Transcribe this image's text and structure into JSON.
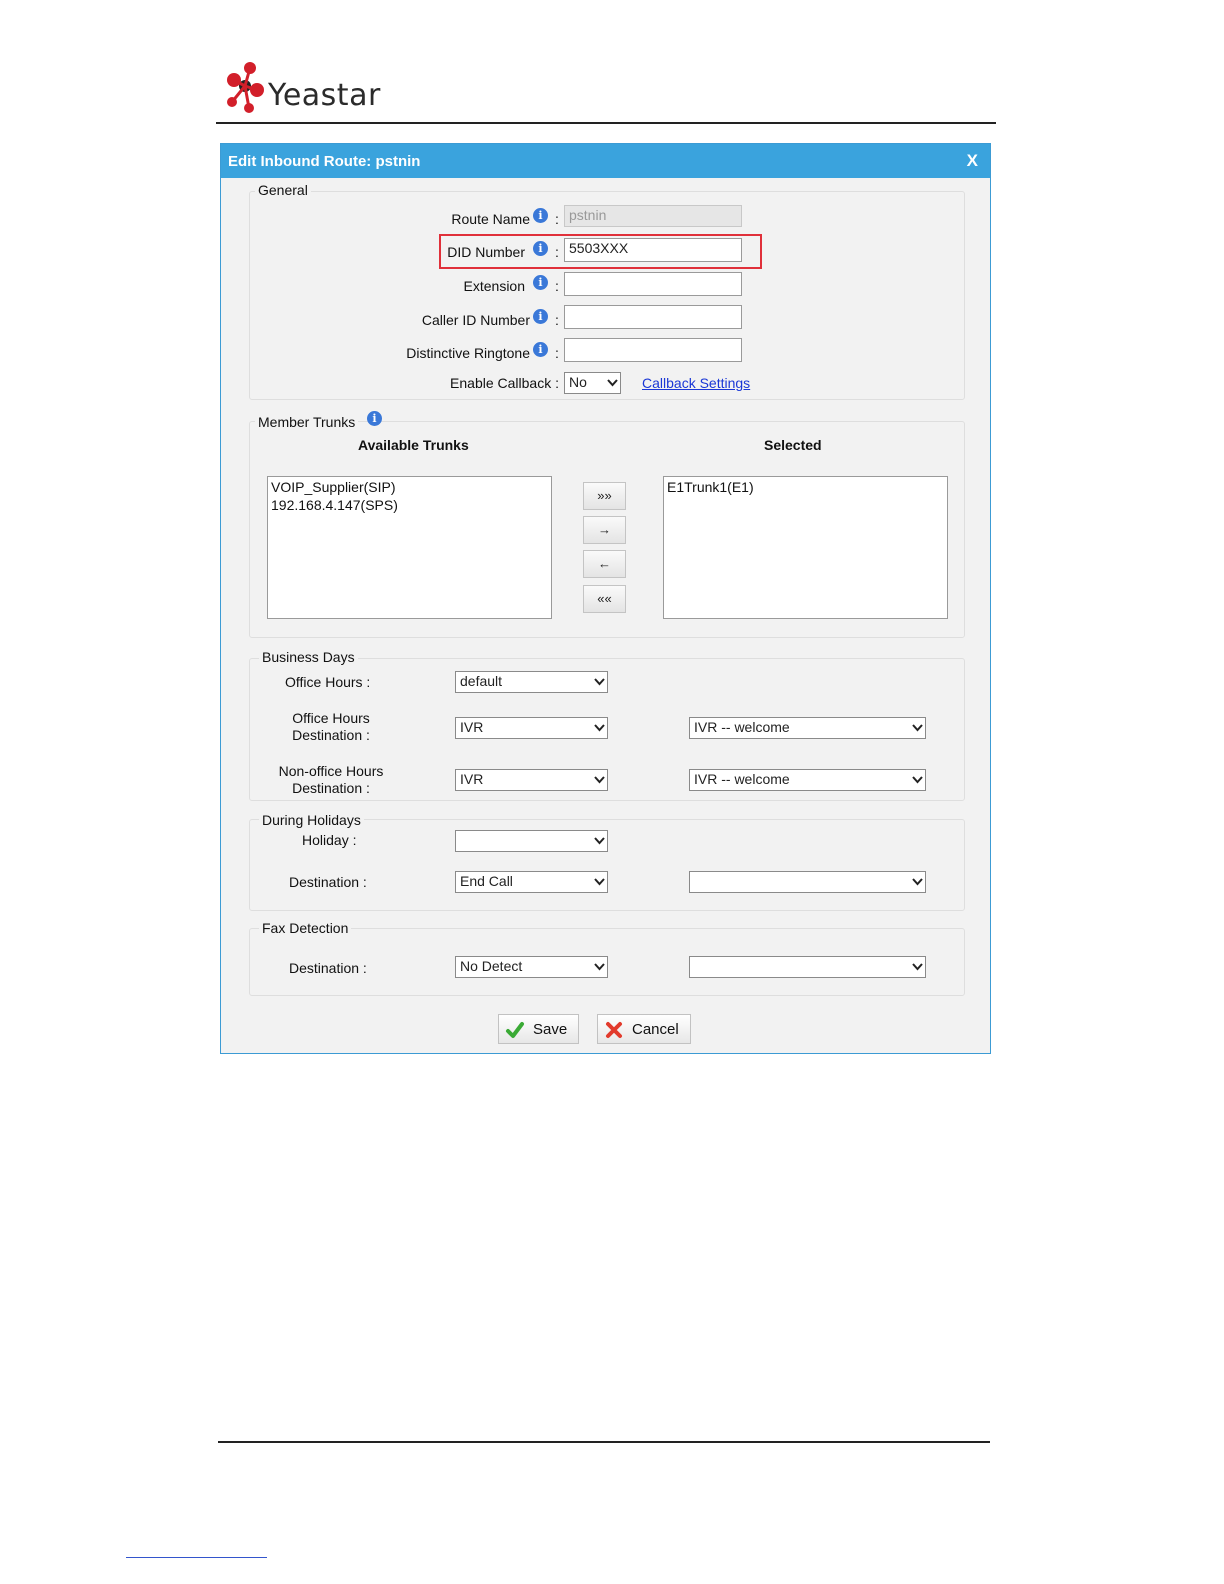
{
  "brand": {
    "logo_text": "Yeastar"
  },
  "dialog": {
    "title": "Edit Inbound Route: pstnin",
    "close_label": "X"
  },
  "general": {
    "legend": "General",
    "route_name": {
      "label": "Route Name",
      "value": "pstnin"
    },
    "did_number": {
      "label": "DID Number",
      "value": "5503XXX"
    },
    "extension": {
      "label": "Extension",
      "value": ""
    },
    "caller_id_number": {
      "label": "Caller ID Number",
      "value": ""
    },
    "distinctive_ringtone": {
      "label": "Distinctive Ringtone",
      "value": ""
    },
    "enable_callback": {
      "label": "Enable Callback :",
      "value": "No",
      "link": "Callback Settings"
    },
    "colon": ":"
  },
  "member_trunks": {
    "legend": "Member Trunks",
    "available_header": "Available Trunks",
    "selected_header": "Selected",
    "available": [
      "VOIP_Supplier(SIP)",
      "192.168.4.147(SPS)"
    ],
    "selected": [
      "E1Trunk1(E1)"
    ],
    "buttons": {
      "add_all": "»»",
      "add": "→",
      "remove": "←",
      "remove_all": "««"
    }
  },
  "business_days": {
    "legend": "Business Days",
    "office_hours": {
      "label": "Office Hours :",
      "value": "default"
    },
    "office_hours_destination": {
      "label_line1": "Office Hours",
      "label_line2": "Destination :",
      "type": "IVR",
      "target": "IVR -- welcome"
    },
    "non_office_hours_destination": {
      "label_line1": "Non-office Hours",
      "label_line2": "Destination :",
      "type": "IVR",
      "target": "IVR -- welcome"
    }
  },
  "holidays": {
    "legend": "During Holidays",
    "holiday": {
      "label": "Holiday :",
      "value": ""
    },
    "destination": {
      "label": "Destination :",
      "type": "End Call",
      "target": ""
    }
  },
  "fax": {
    "legend": "Fax Detection",
    "destination": {
      "label": "Destination :",
      "type": "No Detect",
      "target": ""
    }
  },
  "actions": {
    "save": "Save",
    "cancel": "Cancel"
  },
  "colors": {
    "titlebar": "#3aa3dd",
    "highlight": "#e0303a",
    "link": "#1a37d6"
  }
}
